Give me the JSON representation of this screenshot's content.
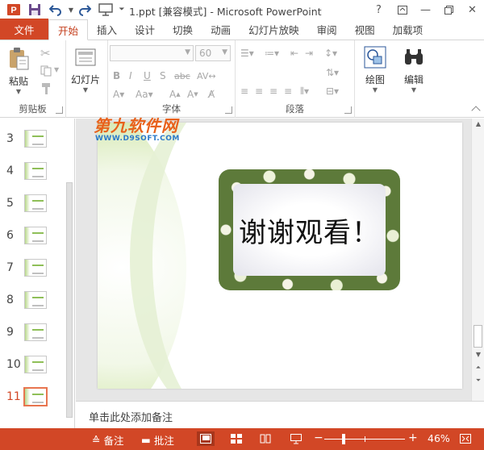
{
  "window": {
    "title": "1.ppt [兼容模式] - Microsoft PowerPoint",
    "controls": {
      "help": "?",
      "minimize": "—",
      "close": "✕"
    }
  },
  "tabs": [
    "文件",
    "开始",
    "插入",
    "设计",
    "切换",
    "动画",
    "幻灯片放映",
    "审阅",
    "视图",
    "加载项"
  ],
  "active_tab": "开始",
  "ribbon": {
    "clipboard": {
      "paste_label": "粘贴",
      "group_label": "剪贴板"
    },
    "slides": {
      "new_slide_label": "幻灯片"
    },
    "font": {
      "group_label": "字体",
      "font_size": "60"
    },
    "paragraph": {
      "group_label": "段落"
    },
    "drawing": {
      "label": "绘图"
    },
    "editing": {
      "label": "编辑"
    }
  },
  "thumbnails": [
    {
      "number": "3",
      "selected": false
    },
    {
      "number": "4",
      "selected": false
    },
    {
      "number": "5",
      "selected": false
    },
    {
      "number": "6",
      "selected": false
    },
    {
      "number": "7",
      "selected": false
    },
    {
      "number": "8",
      "selected": false
    },
    {
      "number": "9",
      "selected": false
    },
    {
      "number": "10",
      "selected": false
    },
    {
      "number": "11",
      "selected": true
    }
  ],
  "slide": {
    "text": "谢谢观看！",
    "watermark_main": "第九软件网",
    "watermark_url": "WWW.D9SOFT.COM"
  },
  "notes": {
    "placeholder": "单击此处添加备注"
  },
  "status": {
    "notes_label": "备注",
    "comments_label": "批注",
    "zoom": "46%",
    "zoom_minus": "−",
    "zoom_plus": "+"
  },
  "colors": {
    "accent": "#d24726",
    "slide_green": "#9cc865"
  }
}
